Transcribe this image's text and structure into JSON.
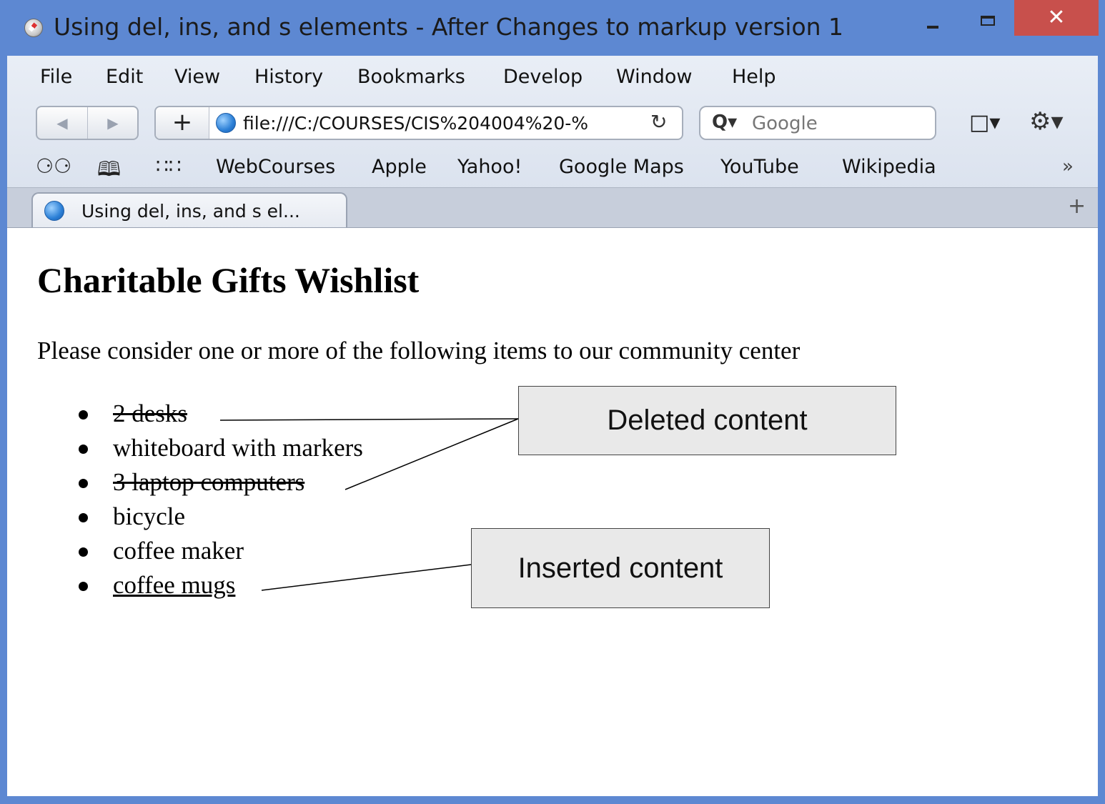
{
  "window": {
    "title": "Using del, ins, and s elements - After Changes to markup version 1",
    "close_glyph": "✕"
  },
  "menu": [
    "File",
    "Edit",
    "View",
    "History",
    "Bookmarks",
    "Develop",
    "Window",
    "Help"
  ],
  "toolbar": {
    "back_glyph": "◀",
    "forward_glyph": "▶",
    "add_glyph": "+",
    "url": "file:///C:/COURSES/CIS%204004%20-%",
    "reload_glyph": "↻",
    "search_placeholder": "Google",
    "search_glyph": "Q▾",
    "page_menu_glyph": "□▾",
    "gear_glyph": "⚙▾"
  },
  "bookmarks": {
    "icons": [
      "reading-list-icon",
      "book-icon",
      "grid-icon"
    ],
    "reading_glyph": "⚆⚆",
    "book_glyph": "🕮",
    "grid_glyph": "∷∷",
    "items": [
      "WebCourses",
      "Apple",
      "Yahoo!",
      "Google Maps",
      "YouTube",
      "Wikipedia"
    ],
    "more_glyph": "»"
  },
  "tabs": {
    "active_title": "Using del, ins, and s el...",
    "add_glyph": "+"
  },
  "page": {
    "heading": "Charitable Gifts Wishlist",
    "intro": "Please consider one or more of the following items to our community center",
    "items": [
      {
        "text": "2 desks",
        "state": "deleted"
      },
      {
        "text": "whiteboard with markers",
        "state": "normal"
      },
      {
        "text": "3 laptop computers",
        "state": "deleted"
      },
      {
        "text": "bicycle",
        "state": "normal"
      },
      {
        "text": "coffee maker",
        "state": "normal"
      },
      {
        "text": "coffee mugs",
        "state": "inserted"
      }
    ],
    "callouts": {
      "deleted": "Deleted content",
      "inserted": "Inserted content"
    }
  }
}
